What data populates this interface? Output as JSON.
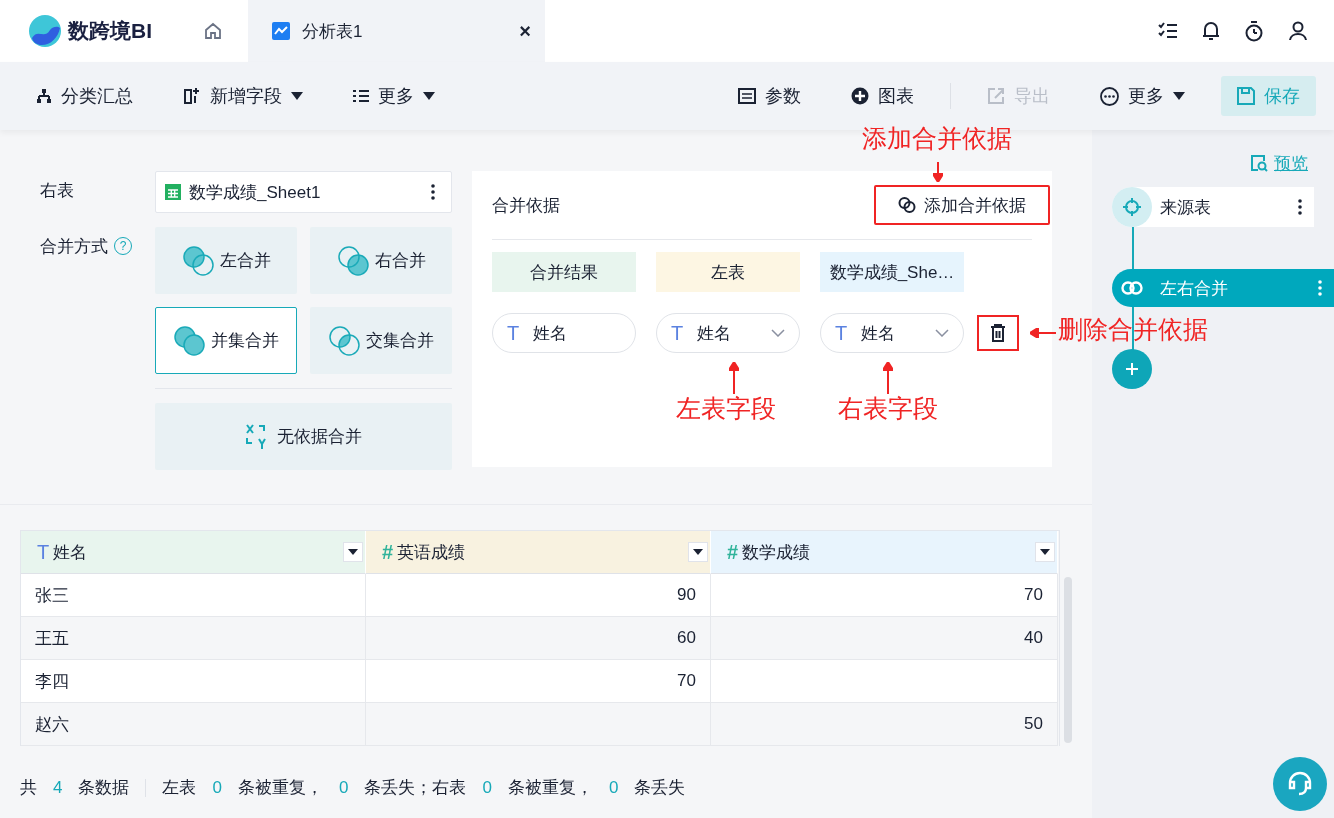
{
  "app": {
    "logo": "数跨境BI"
  },
  "tabs": [
    {
      "kind": "home",
      "selected": false
    },
    {
      "kind": "sheet",
      "label": "分析表1",
      "selected": true,
      "close": "×"
    }
  ],
  "toolbar": {
    "left": [
      {
        "label": "分类汇总",
        "dropdown": false
      },
      {
        "label": "新增字段",
        "dropdown": true
      },
      {
        "label": "更多",
        "dropdown": true
      }
    ],
    "right": [
      {
        "label": "参数",
        "dropdown": false,
        "disabled": false,
        "kind": "plain"
      },
      {
        "label": "图表",
        "dropdown": false,
        "disabled": false,
        "kind": "plain"
      },
      {
        "label": "导出",
        "dropdown": false,
        "disabled": true,
        "kind": "plain"
      },
      {
        "label": "更多",
        "dropdown": true,
        "disabled": false,
        "kind": "plain"
      },
      {
        "label": "保存",
        "dropdown": false,
        "disabled": false,
        "kind": "primary"
      }
    ]
  },
  "config": {
    "right_table": {
      "label": "右表",
      "value": "数学成绩_Sheet1"
    },
    "merge_method": {
      "label": "合并方式",
      "help": "?",
      "options": [
        {
          "label": "左合并",
          "selected": false
        },
        {
          "label": "右合并",
          "selected": false
        },
        {
          "label": "并集合并",
          "selected": true
        },
        {
          "label": "交集合并",
          "selected": false
        }
      ],
      "no_basis": {
        "label": "无依据合并",
        "selected": false
      }
    }
  },
  "basis": {
    "title": "合并依据",
    "add_button": {
      "label": "添加合并依据",
      "highlighted": true
    },
    "headers": [
      {
        "label": "合并结果",
        "color": "#e8f5ee"
      },
      {
        "label": "左表",
        "color": "#fdf6e3"
      },
      {
        "label": "数学成绩_She…",
        "color": "#e6f4fd"
      }
    ],
    "fields": [
      {
        "type_icon": "T",
        "value": "姓名",
        "dropdown": false
      },
      {
        "type_icon": "T",
        "value": "姓名",
        "dropdown": true
      },
      {
        "type_icon": "T",
        "value": "姓名",
        "dropdown": true
      }
    ],
    "delete_highlighted": true
  },
  "annotations": [
    {
      "text": "添加合并依据"
    },
    {
      "text": "删除合并依据"
    },
    {
      "text": "左表字段"
    },
    {
      "text": "右表字段"
    }
  ],
  "sidebar": {
    "preview": "预览",
    "nodes": [
      {
        "label": "来源表",
        "selected": false
      },
      {
        "label": "左右合并",
        "selected": true
      }
    ]
  },
  "table": {
    "columns": [
      {
        "type_icon": "T",
        "name": "姓名",
        "kind": "text",
        "color": "#e8f5ee"
      },
      {
        "type_icon": "#",
        "name": "英语成绩",
        "kind": "number",
        "color": "#f8f2e0"
      },
      {
        "type_icon": "#",
        "name": "数学成绩",
        "kind": "number",
        "color": "#e8f4fd"
      }
    ],
    "rows": [
      [
        "张三",
        "90",
        "70"
      ],
      [
        "王五",
        "60",
        "40"
      ],
      [
        "李四",
        "70",
        null
      ],
      [
        "赵六",
        null,
        "50"
      ]
    ]
  },
  "footer": [
    [
      {
        "text": "共",
        "kind": "text"
      },
      {
        "text": "4",
        "kind": "count"
      },
      {
        "text": "条数据",
        "kind": "text"
      }
    ],
    [
      {
        "text": "左表",
        "kind": "text"
      },
      {
        "text": "0",
        "kind": "count"
      },
      {
        "text": "条被重复，",
        "kind": "text"
      },
      {
        "text": "0",
        "kind": "count"
      },
      {
        "text": "条丢失；右表",
        "kind": "text"
      },
      {
        "text": "0",
        "kind": "count"
      },
      {
        "text": "条被重复，",
        "kind": "text"
      },
      {
        "text": "0",
        "kind": "count"
      },
      {
        "text": "条丢失",
        "kind": "text"
      }
    ]
  ]
}
